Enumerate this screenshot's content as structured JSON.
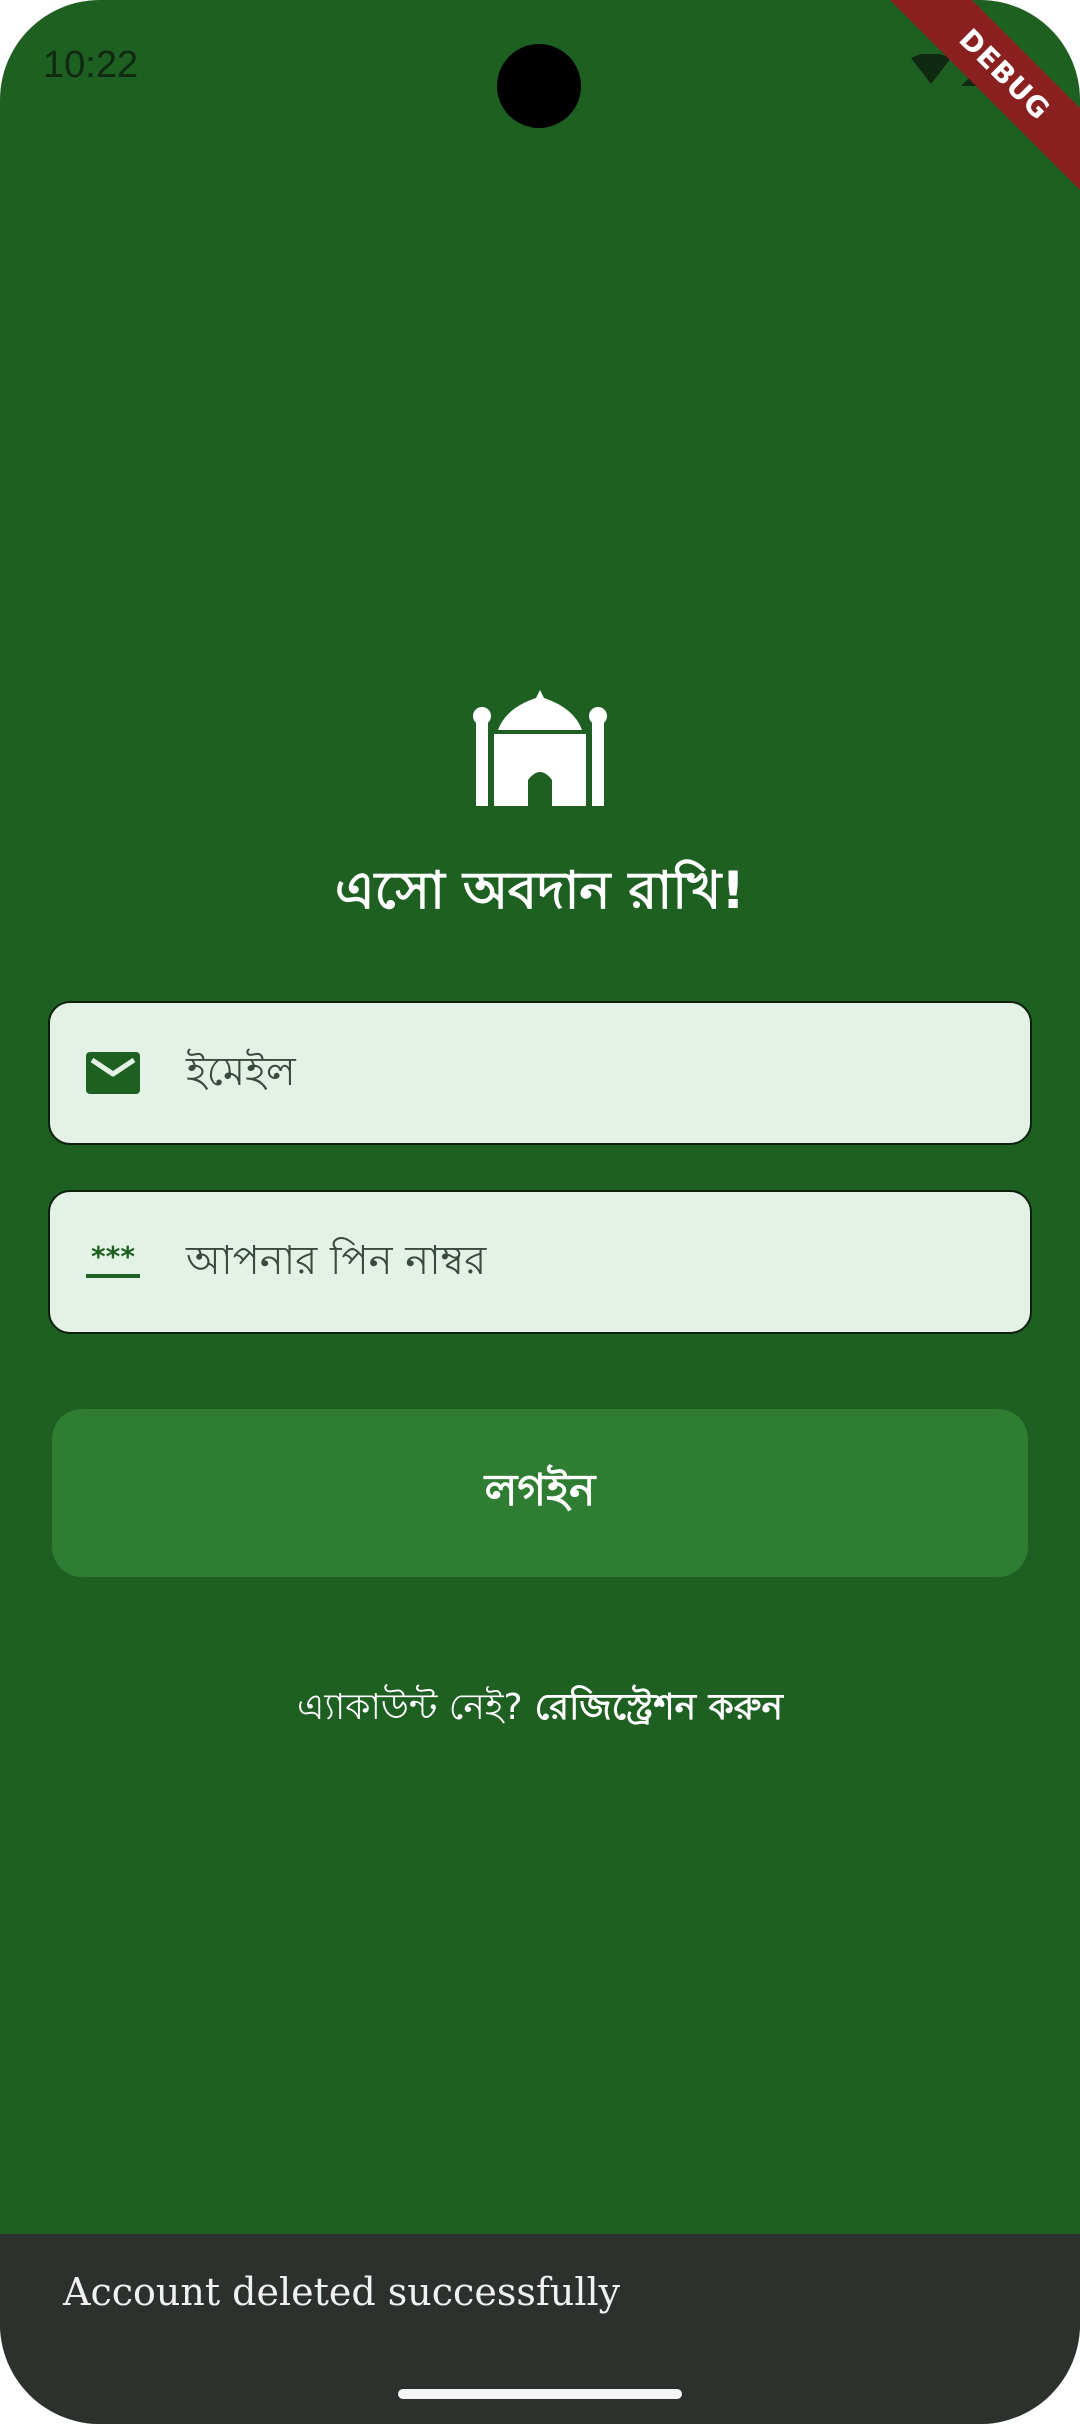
{
  "status_bar": {
    "time": "10:22",
    "icons": [
      "wifi-icon",
      "signal-icon",
      "battery-icon"
    ]
  },
  "debug_banner": "DEBUG",
  "logo": {
    "icon": "mosque-icon"
  },
  "title": "এসো অবদান রাখি!",
  "form": {
    "email": {
      "placeholder": "ইমেইল",
      "icon": "mail-icon"
    },
    "pin": {
      "placeholder": "আপনার পিন নাম্বর",
      "icon": "password-icon"
    }
  },
  "login_button": "লগইন",
  "register": {
    "prompt": "এ্যাকাউন্ট নেই?",
    "link": "রেজিস্ট্রেশন করুন"
  },
  "snackbar": {
    "message": "Account deleted successfully"
  },
  "colors": {
    "background": "#1e5f22",
    "field_background": "#e3f2e5",
    "button": "#2f7d32",
    "snackbar": "#2d312d"
  }
}
